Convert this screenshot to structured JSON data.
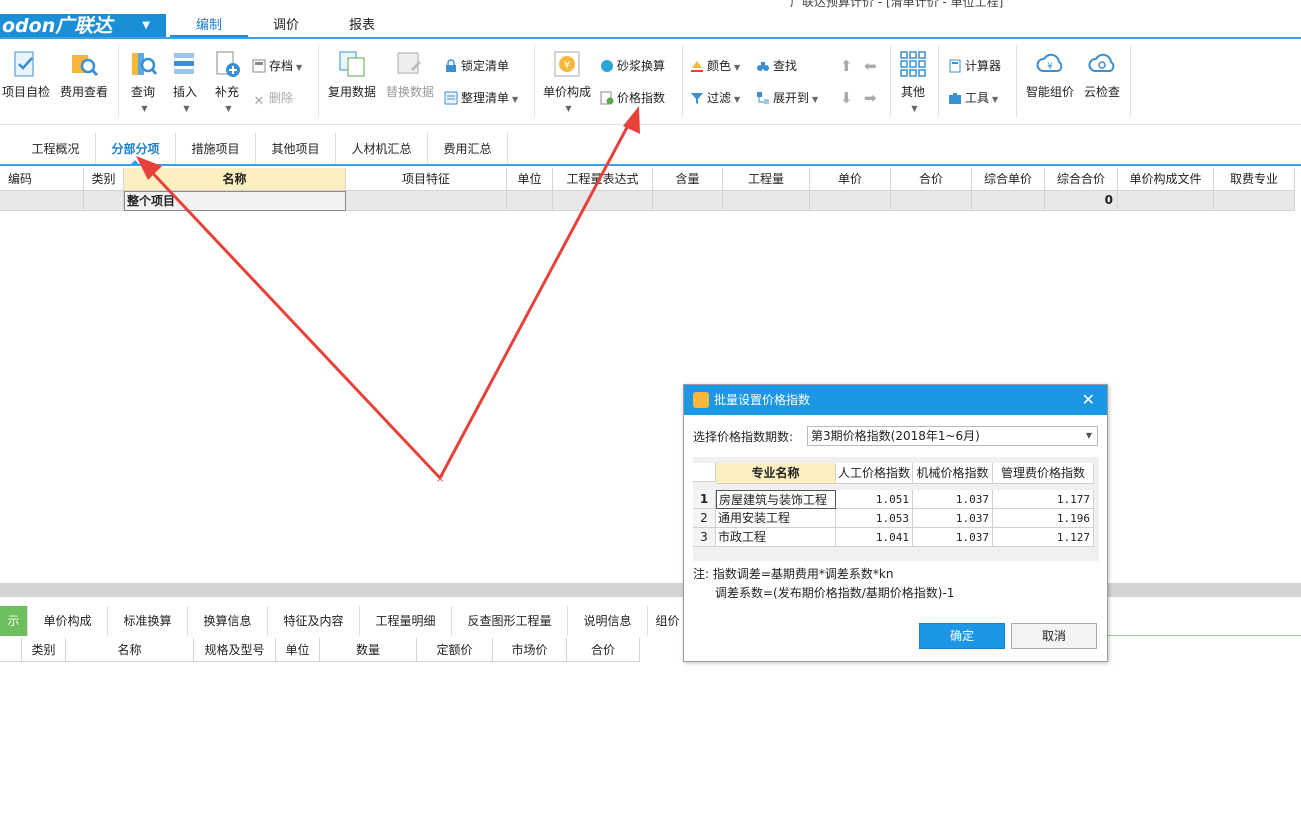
{
  "app": {
    "logo": "odon广联达",
    "doc_title": "广联达预算计价 - [清单计价 - 单位工程]"
  },
  "menu_tabs": [
    "编制",
    "调价",
    "报表"
  ],
  "ribbon": {
    "project_check": "项目自检",
    "fee_view": "费用查看",
    "query": "查询",
    "insert": "插入",
    "supplement": "补充",
    "archive": "存档",
    "delete": "删除",
    "reuse_data": "复用数据",
    "replace_data": "替换数据",
    "lock_list": "锁定清单",
    "organize_list": "整理清单",
    "unit_price_composition": "单价构成",
    "mortar_conversion": "砂浆换算",
    "price_index": "价格指数",
    "color": "颜色",
    "find": "查找",
    "filter": "过滤",
    "expand_to": "展开到",
    "other": "其他",
    "calculator": "计算器",
    "tools": "工具",
    "smart_pricing": "智能组价",
    "cloud_check": "云检查"
  },
  "nav_tabs": [
    "工程概况",
    "分部分项",
    "措施项目",
    "其他项目",
    "人材机汇总",
    "费用汇总"
  ],
  "grid": {
    "headers": [
      "编码",
      "类别",
      "名称",
      "项目特征",
      "单位",
      "工程量表达式",
      "含量",
      "工程量",
      "单价",
      "合价",
      "综合单价",
      "综合合价",
      "单价构成文件",
      "取费专业"
    ],
    "row": {
      "name": "整个项目",
      "total": "0"
    }
  },
  "bottom_tabs": [
    "示",
    "单价构成",
    "标准换算",
    "换算信息",
    "特征及内容",
    "工程量明细",
    "反查图形工程量",
    "说明信息",
    "组价"
  ],
  "bottom_headers": [
    "类别",
    "名称",
    "规格及型号",
    "单位",
    "数量",
    "定额价",
    "市场价",
    "合价"
  ],
  "dialog": {
    "title": "批量设置价格指数",
    "select_label": "选择价格指数期数:",
    "select_value": "第3期价格指数(2018年1~6月)",
    "columns": [
      "专业名称",
      "人工价格指数",
      "机械价格指数",
      "管理费价格指数"
    ],
    "rows": [
      {
        "no": "1",
        "name": "房屋建筑与装饰工程",
        "labor": "1.051",
        "machine": "1.037",
        "mgmt": "1.177"
      },
      {
        "no": "2",
        "name": "通用安装工程",
        "labor": "1.053",
        "machine": "1.037",
        "mgmt": "1.196"
      },
      {
        "no": "3",
        "name": "市政工程",
        "labor": "1.041",
        "machine": "1.037",
        "mgmt": "1.127"
      }
    ],
    "note1": "注: 指数调差=基期费用*调差系数*kn",
    "note2": "调差系数=(发布期价格指数/基期价格指数)-1",
    "ok": "确定",
    "cancel": "取消"
  },
  "colors": {
    "accent": "#1b97e6",
    "arrow": "#e8403b",
    "selected_header": "#fdf0c0",
    "bottom_tab_active": "#6cbf5c"
  }
}
